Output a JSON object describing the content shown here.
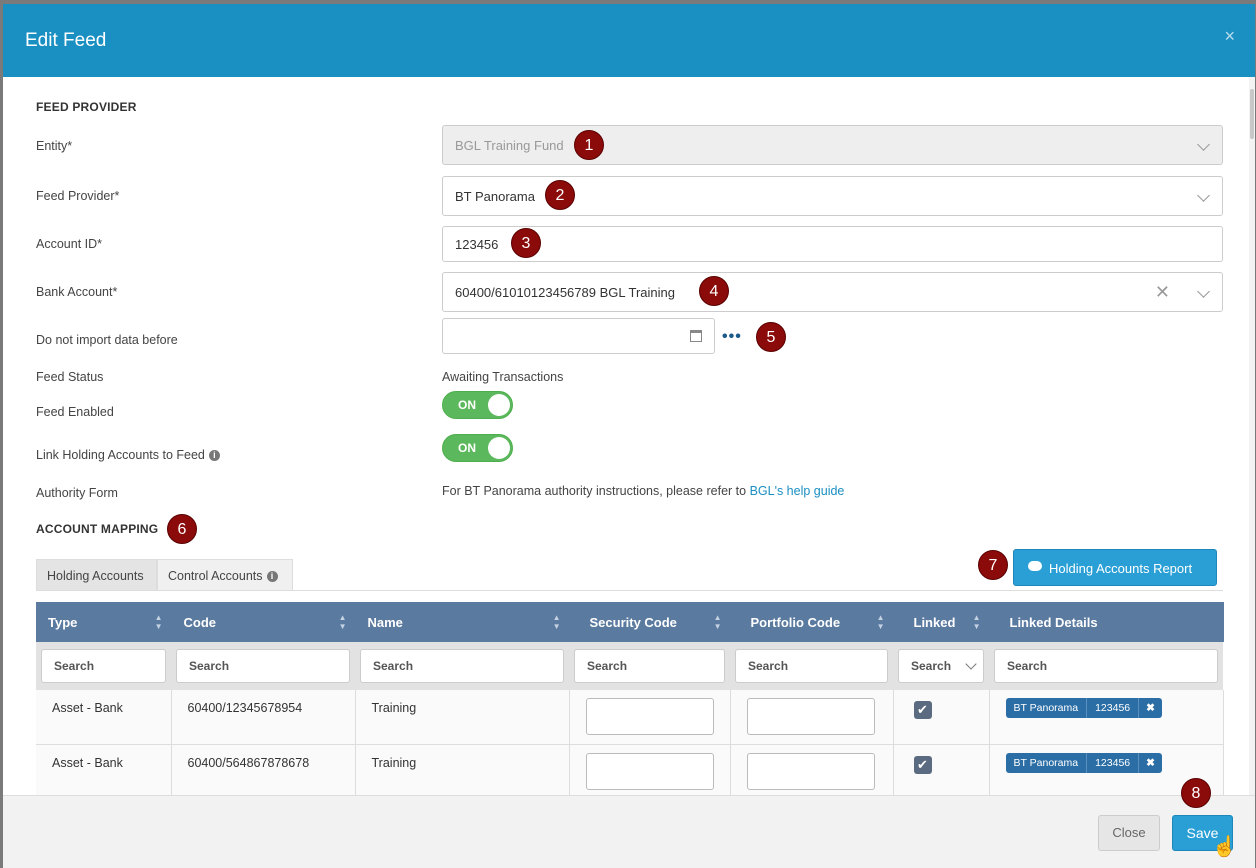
{
  "modal": {
    "title": "Edit Feed",
    "close_glyph": "×"
  },
  "feed_provider_section": {
    "title": "FEED PROVIDER",
    "entity": {
      "label": "Entity*",
      "value": "BGL Training Fund",
      "badge": "1"
    },
    "feed_provider": {
      "label": "Feed Provider*",
      "value": "BT Panorama",
      "badge": "2"
    },
    "account_id": {
      "label": "Account ID*",
      "value": "123456",
      "badge": "3"
    },
    "bank_account": {
      "label": "Bank Account*",
      "value": "60400/61010123456789 BGL Training",
      "badge": "4",
      "clear_glyph": "✕"
    },
    "import_before": {
      "label": "Do not import data before",
      "value": "",
      "badge": "5",
      "more_glyph": "•••"
    },
    "feed_status": {
      "label": "Feed Status",
      "value": "Awaiting Transactions"
    },
    "feed_enabled": {
      "label": "Feed Enabled",
      "toggle": "ON"
    },
    "link_holding": {
      "label": "Link Holding Accounts to Feed",
      "toggle": "ON"
    },
    "authority_form": {
      "label": "Authority Form",
      "text": "For BT Panorama authority instructions, please refer to",
      "link": "BGL's help guide"
    }
  },
  "account_mapping": {
    "title": "ACCOUNT MAPPING",
    "badge": "6",
    "report_badge": "7",
    "tabs": [
      {
        "label": "Holding Accounts"
      },
      {
        "label": "Control Accounts"
      }
    ],
    "report_button": "Holding Accounts Report",
    "columns": [
      "Type",
      "Code",
      "Name",
      "Security Code",
      "Portfolio Code",
      "Linked",
      "Linked Details"
    ],
    "search_placeholder": "Search",
    "rows": [
      {
        "type": "Asset - Bank",
        "code": "60400/12345678954",
        "name": "Training",
        "linked": true,
        "chip_provider": "BT Panorama",
        "chip_account": "123456"
      },
      {
        "type": "Asset - Bank",
        "code": "60400/564867878678",
        "name": "Training",
        "linked": true,
        "chip_provider": "BT Panorama",
        "chip_account": "123456"
      }
    ]
  },
  "footer": {
    "close": "Close",
    "save": "Save",
    "save_badge": "8"
  },
  "colors": {
    "header": "#1a8fc2",
    "badge": "#8b0a0a",
    "table_header": "#5a7aa0",
    "toggle_on": "#5cb85c",
    "primary_button": "#2a9fd6"
  },
  "icons": [
    "close-icon",
    "chevron-down-icon",
    "clear-icon",
    "calendar-icon",
    "more-options-icon",
    "info-icon",
    "cloud-download-icon",
    "sort-icon",
    "check-icon",
    "remove-chip-icon",
    "pointer-cursor-icon"
  ]
}
